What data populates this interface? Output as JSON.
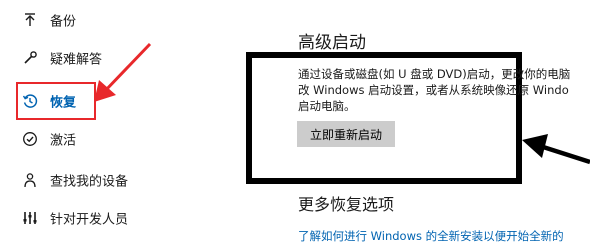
{
  "sidebar": {
    "items": [
      {
        "label": "备份",
        "icon": "arrow-up-icon"
      },
      {
        "label": "疑难解答",
        "icon": "wrench-icon"
      },
      {
        "label": "恢复",
        "icon": "history-icon",
        "active": true
      },
      {
        "label": "激活",
        "icon": "check-circle-icon"
      },
      {
        "label": "查找我的设备",
        "icon": "person-location-icon"
      },
      {
        "label": "针对开发人员",
        "icon": "developer-tools-icon"
      }
    ]
  },
  "main": {
    "advanced_title": "高级启动",
    "description_lines": [
      "通过设备或磁盘(如 U 盘或 DVD)启动，更改你的电脑",
      "改 Windows 启动设置，或者从系统映像还原 Windo",
      "启动电脑。"
    ],
    "restart_button": "立即重新启动",
    "more_title": "更多恢复选项",
    "link": "了解如何进行 Windows 的全新安装以便开始全新的"
  },
  "colors": {
    "accent": "#0063b1",
    "highlight": "#e8282b",
    "frame": "#000000",
    "button_bg": "#cccccc"
  }
}
